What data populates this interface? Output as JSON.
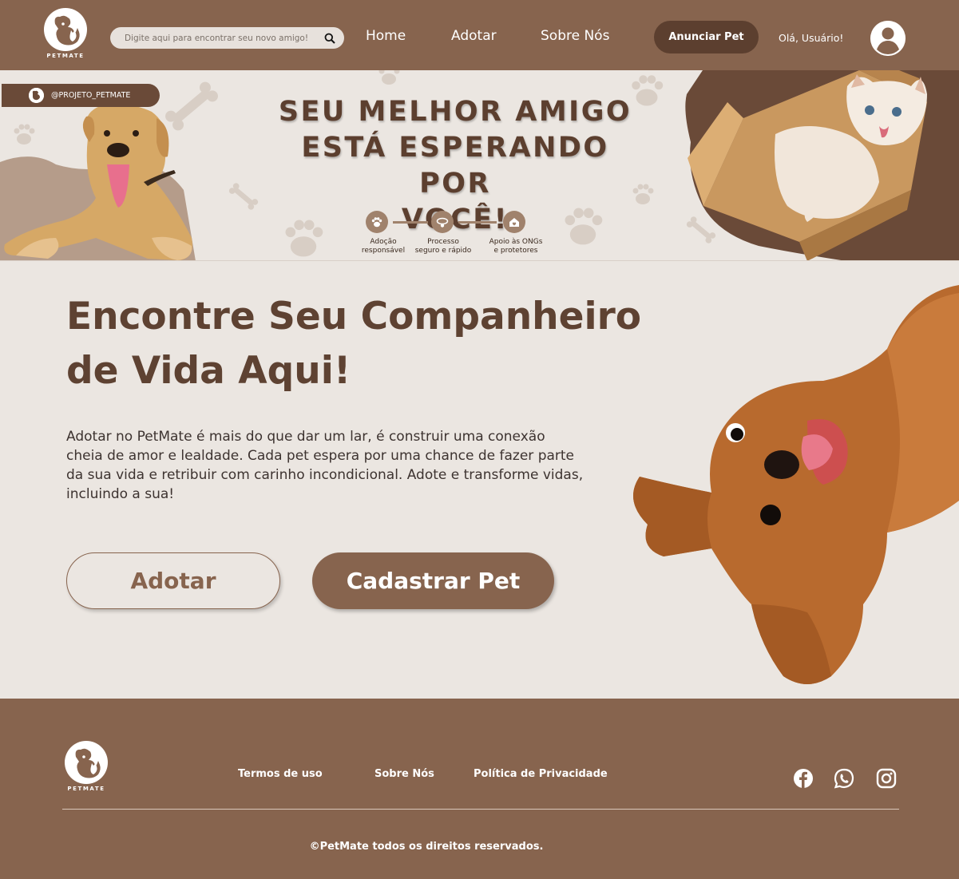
{
  "brand": {
    "name": "PETMATE"
  },
  "header": {
    "search": {
      "placeholder": "Digite aqui para encontrar seu novo amigo!"
    },
    "nav": {
      "home": "Home",
      "adotar": "Adotar",
      "sobre": "Sobre Nós"
    },
    "cta": "Anunciar Pet",
    "greeting": "Olá, Usuário!"
  },
  "banner": {
    "instagram": "@PROJETO_PETMATE",
    "title_lines": [
      "SEU MELHOR AMIGO",
      "ESTÁ ESPERANDO POR",
      "VOCÊ!"
    ],
    "features": [
      {
        "icon": "paw-icon",
        "line1": "Adoção",
        "line2": "responsável"
      },
      {
        "icon": "collar-icon",
        "line1": "Processo",
        "line2": "seguro e rápido"
      },
      {
        "icon": "house-heart-icon",
        "line1": "Apoio às ONGs",
        "line2": "e protetores"
      }
    ]
  },
  "hero": {
    "title_line1": "Encontre Seu Companheiro",
    "title_line2": "de Vida Aqui!",
    "description": "Adotar no PetMate é mais do que dar um lar, é construir uma conexão cheia de amor e lealdade. Cada pet espera por uma chance de fazer parte da sua vida e retribuir com carinho incondicional. Adote e transforme vidas, incluindo a sua!",
    "btn_adotar": "Adotar",
    "btn_cadastrar": "Cadastrar Pet"
  },
  "footer": {
    "links": {
      "termos": "Termos de uso",
      "sobre": "Sobre Nós",
      "politica": "Política de Privacidade"
    },
    "social": [
      "facebook-icon",
      "whatsapp-icon",
      "instagram-icon"
    ],
    "copyright": "©PetMate todos os direitos reservados."
  },
  "colors": {
    "primary_brown": "#87644e",
    "dark_brown": "#5c3f2f",
    "background": "#ebe6e1",
    "title_brown": "#5e4232"
  }
}
